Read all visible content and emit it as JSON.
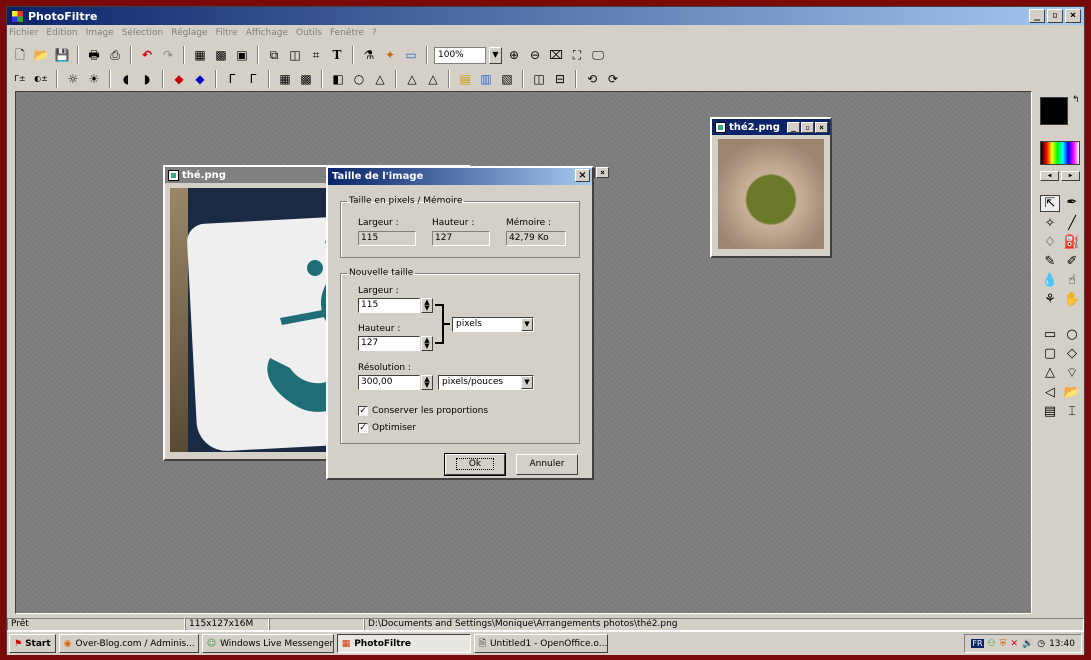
{
  "app": {
    "title": "PhotoFiltre"
  },
  "menu": [
    "Fichier",
    "Edition",
    "Image",
    "Sélection",
    "Réglage",
    "Filtre",
    "Affichage",
    "Outils",
    "Fenêtre",
    "?"
  ],
  "toolbar": {
    "zoom": "100%"
  },
  "windows": {
    "the": {
      "title": "thé.png"
    },
    "the2": {
      "title": "thé2.png"
    }
  },
  "dialog": {
    "title": "Taille de l'image",
    "pixels_group": "Taille en pixels / Mémoire",
    "width_label": "Largeur :",
    "height_label": "Hauteur :",
    "memory_label": "Mémoire :",
    "width_value": "115",
    "height_value": "127",
    "memory_value": "42,79 Ko",
    "new_group": "Nouvelle taille",
    "new_width_label": "Largeur :",
    "new_width": "115",
    "new_height_label": "Hauteur :",
    "new_height": "127",
    "unit": "pixels",
    "resolution_label": "Résolution :",
    "resolution": "300,00",
    "resolution_unit": "pixels/pouces",
    "keep_proportions": "Conserver les proportions",
    "optimize": "Optimiser",
    "ok": "Ok",
    "cancel": "Annuler"
  },
  "status": {
    "state": "Prêt",
    "size": "115x127x16M",
    "path": "D:\\Documents and Settings\\Monique\\Arrangements photos\\thé2.png"
  },
  "taskbar": {
    "start": "Start",
    "items": [
      "Over-Blog.com / Adminis...",
      "Windows Live Messenger",
      "PhotoFiltre",
      "Untitled1 - OpenOffice.o..."
    ],
    "clock": "13:40",
    "lang": "FR"
  },
  "colors": {
    "accent": "#0a246a",
    "border": "#7a0a0a",
    "tea_blue": "#1f6e77"
  }
}
